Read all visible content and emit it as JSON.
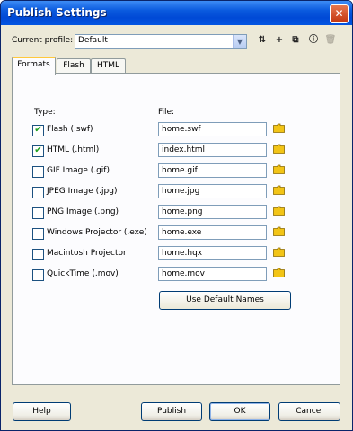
{
  "window": {
    "title": "Publish Settings",
    "close_glyph": "✕"
  },
  "profile": {
    "label": "Current profile:",
    "value": "Default",
    "toolbar": [
      {
        "name": "import-export-profile-icon",
        "glyph": "⇅"
      },
      {
        "name": "create-profile-icon",
        "glyph": "+"
      },
      {
        "name": "duplicate-profile-icon",
        "glyph": "⧉"
      },
      {
        "name": "profile-properties-icon",
        "glyph": "ⓘ"
      },
      {
        "name": "delete-profile-icon",
        "glyph": "🗑"
      }
    ]
  },
  "tabs": [
    {
      "label": "Formats",
      "active": true
    },
    {
      "label": "Flash",
      "active": false
    },
    {
      "label": "HTML",
      "active": false
    }
  ],
  "formats": {
    "type_header": "Type:",
    "file_header": "File:",
    "items": [
      {
        "label": "Flash  (.swf)",
        "checked": true,
        "file": "home.swf"
      },
      {
        "label": "HTML (.html)",
        "checked": true,
        "file": "index.html"
      },
      {
        "label": "GIF Image (.gif)",
        "checked": false,
        "file": "home.gif"
      },
      {
        "label": "JPEG Image (.jpg)",
        "checked": false,
        "file": "home.jpg"
      },
      {
        "label": "PNG Image (.png)",
        "checked": false,
        "file": "home.png"
      },
      {
        "label": "Windows Projector (.exe)",
        "checked": false,
        "file": "home.exe"
      },
      {
        "label": "Macintosh Projector",
        "checked": false,
        "file": "home.hqx"
      },
      {
        "label": "QuickTime (.mov)",
        "checked": false,
        "file": "home.mov"
      }
    ],
    "default_names_label": "Use Default Names"
  },
  "buttons": {
    "help": "Help",
    "publish": "Publish",
    "ok": "OK",
    "cancel": "Cancel"
  },
  "colors": {
    "folder": "#f2c416",
    "check": "#21a121",
    "title_bar": "#0a5ade"
  }
}
